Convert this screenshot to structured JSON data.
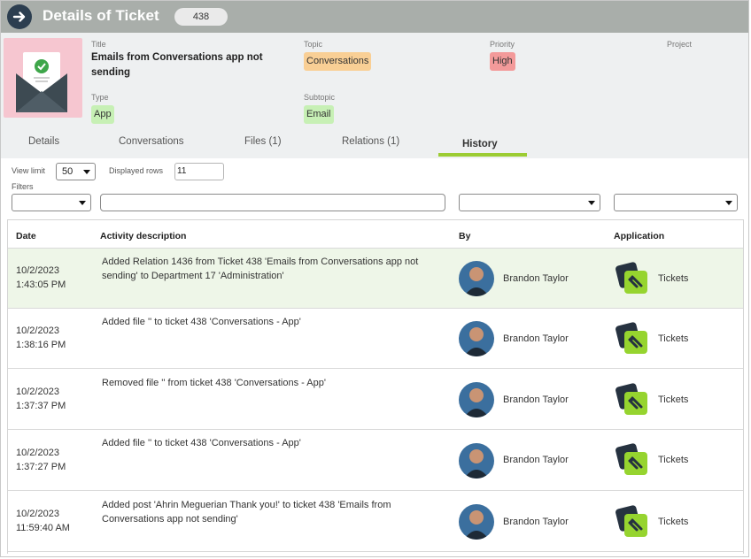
{
  "header": {
    "title": "Details of Ticket",
    "ticket_number": "438"
  },
  "ticket": {
    "title_label": "Title",
    "title_value": "Emails from Conversations app not sending",
    "topic_label": "Topic",
    "topic_value": "Conversations",
    "priority_label": "Priority",
    "priority_value": "High",
    "project_label": "Project",
    "type_label": "Type",
    "type_value": "App",
    "subtopic_label": "Subtopic",
    "subtopic_value": "Email"
  },
  "tabs": [
    {
      "label": "Details"
    },
    {
      "label": "Conversations"
    },
    {
      "label": "Files (1)"
    },
    {
      "label": "Relations (1)"
    },
    {
      "label": "History"
    }
  ],
  "active_tab": "History",
  "controls": {
    "view_limit_label": "View limit",
    "view_limit_value": "50",
    "displayed_rows_label": "Displayed rows",
    "displayed_rows_value": "11",
    "filters_label": "Filters"
  },
  "table": {
    "columns": {
      "date": "Date",
      "activity": "Activity description",
      "by": "By",
      "application": "Application"
    },
    "rows": [
      {
        "date_line1": "10/2/2023",
        "date_line2": "1:43:05 PM",
        "description": "Added Relation 1436 from Ticket 438 'Emails from Conversations app not sending' to Department 17 'Administration'",
        "by": "Brandon Taylor",
        "application": "Tickets"
      },
      {
        "date_line1": "10/2/2023",
        "date_line2": "1:38:16 PM",
        "description": "Added file '' to ticket 438 'Conversations - App'",
        "by": "Brandon Taylor",
        "application": "Tickets"
      },
      {
        "date_line1": "10/2/2023",
        "date_line2": "1:37:37 PM",
        "description": "Removed file '' from ticket 438 'Conversations - App'",
        "by": "Brandon Taylor",
        "application": "Tickets"
      },
      {
        "date_line1": "10/2/2023",
        "date_line2": "1:37:27 PM",
        "description": "Added file '' to ticket 438 'Conversations - App'",
        "by": "Brandon Taylor",
        "application": "Tickets"
      },
      {
        "date_line1": "10/2/2023",
        "date_line2": "11:59:40 AM",
        "description": "Added post 'Ahrin Meguerian Thank you!' to ticket 438 'Emails from Conversations app not sending'",
        "by": "Brandon Taylor",
        "application": "Tickets"
      }
    ]
  },
  "colors": {
    "header_bg": "#a9aeaa",
    "accent_green": "#9ccc33",
    "highlight_row": "#eef6e8",
    "chip_orange": "#f9cf95",
    "chip_red": "#f39a9a",
    "chip_green": "#c7f0b5"
  },
  "icons": {
    "back": "arrow-right-icon",
    "app": "tickets-app-icon",
    "thumbnail": "envelope-checkmark-icon",
    "avatar": "user-avatar"
  }
}
